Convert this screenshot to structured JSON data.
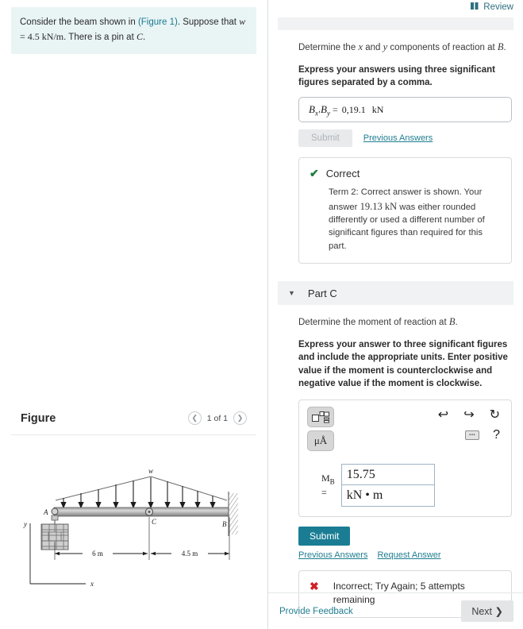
{
  "left": {
    "problem": {
      "line1_pre": "Consider the beam shown in ",
      "figure_link": "(Figure 1)",
      "line1_post": ". Suppose that",
      "var": "w",
      "eq": " = 4.5 ",
      "units": "kN/m",
      "line2_post": ". There is a pin at ",
      "point": "C",
      "period": "."
    },
    "figure": {
      "title": "Figure",
      "prev_icon": "chevron-left-icon",
      "counter": "1 of 1",
      "next_icon": "chevron-right-icon",
      "labels": {
        "load": "w",
        "point_a": "A",
        "point_b": "B",
        "point_c": "C",
        "dim_left": "6 m",
        "dim_right": "4.5 m",
        "axis_x": "x",
        "axis_y": "y"
      }
    }
  },
  "right": {
    "review": {
      "icon": "review-icon",
      "label": "Review"
    },
    "part_b": {
      "question": "Determine the x and y components of reaction at B.",
      "q_pre": "Determine the ",
      "q_mi1": "x",
      "q_mid": " and ",
      "q_mi2": "y",
      "q_post": " components of reaction at ",
      "q_mi3": "B",
      "q_end": ".",
      "instruction": "Express your answers using three significant figures separated by a comma.",
      "answer_label_1": "B",
      "answer_sub_1": "x",
      "answer_comma": ", ",
      "answer_label_2": "B",
      "answer_sub_2": "y",
      "equals": "=",
      "value": "0,19.1",
      "unit": "kN",
      "submit_label": "Submit",
      "previous_answers_label": "Previous Answers",
      "feedback": {
        "icon": "check-icon",
        "title": "Correct",
        "body_pre": "Term 2: Correct answer is shown. Your answer ",
        "body_value": "19.13 kN",
        "body_post": " was either rounded differently or used a different number of significant figures than required for this part."
      }
    },
    "part_c": {
      "caret_icon": "caret-down-icon",
      "title": "Part C",
      "q_pre": "Determine the moment of reaction at ",
      "q_mi": "B",
      "q_end": ".",
      "instruction": "Express your answer to three significant figures and include the appropriate units. Enter positive value if the moment is counterclockwise and negative value if the moment is clockwise.",
      "toolbar": {
        "template_icon": "math-template-icon",
        "units_icon": "micro-angstrom-units-icon",
        "units_label": "μÅ",
        "undo_icon": "undo-arrow-icon",
        "redo_icon": "redo-arrow-icon",
        "reset_icon": "reset-circular-arrow-icon",
        "keyboard_icon": "keyboard-icon",
        "help_icon": "help-question-icon",
        "help_label": "?"
      },
      "lhs_label": "M",
      "lhs_sub": "B",
      "lhs_equals": "=",
      "value": "15.75",
      "unit": "kN • m",
      "submit_label": "Submit",
      "previous_answers_label": "Previous Answers",
      "request_answer_label": "Request Answer",
      "feedback": {
        "icon": "cross-icon",
        "text": "Incorrect; Try Again; 5 attempts remaining"
      }
    },
    "footer": {
      "provide_feedback": "Provide Feedback",
      "next_label": "Next",
      "next_icon": "chevron-right-icon"
    }
  }
}
